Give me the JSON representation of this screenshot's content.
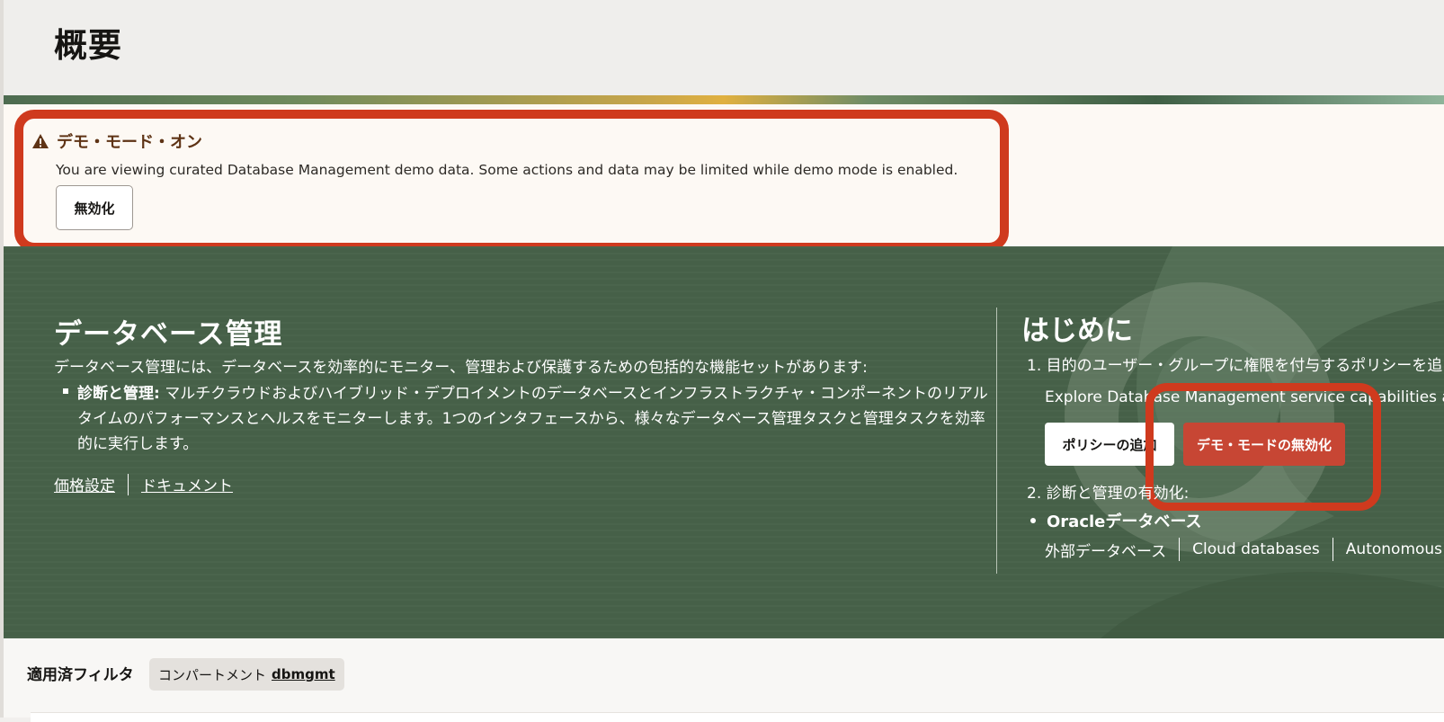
{
  "header": {
    "title": "概要"
  },
  "demo_banner": {
    "title": "デモ・モード・オン",
    "message": "You are viewing curated Database Management demo data. Some actions and data may be limited while demo mode is enabled.",
    "disable_label": "無効化",
    "warning_color": "#5e3315"
  },
  "hero": {
    "title": "データベース管理",
    "description": "データベース管理には、データベースを効率的にモニター、管理および保護するための包括的な機能セットがあります:",
    "bullet_bold": "診断と管理:",
    "bullet_text": " マルチクラウドおよびハイブリッド・デプロイメントのデータベースとインフラストラクチャ・コンポーネントのリアルタイムのパフォーマンスとヘルスをモニターします。1つのインタフェースから、様々なデータベース管理タスクと管理タスクを効率的に実行します。",
    "links": {
      "pricing": "価格設定",
      "docs": "ドキュメント"
    },
    "background_color": "#466048"
  },
  "getting_started": {
    "title": "はじめに",
    "step1": "1. 目的のユーザー・グループに権限を付与するポリシーを追",
    "explore": "Explore Database Management service capabilities a",
    "add_policy_label": "ポリシーの追加",
    "disable_demo_label": "デモ・モードの無効化",
    "step2": "2. 診断と管理の有効化:",
    "oracle_db": "Oracleデータベース",
    "db_links": [
      "外部データベース",
      "Cloud databases",
      "Autonomous"
    ],
    "primary_color": "#c74634"
  },
  "filters": {
    "label": "適用済フィルタ",
    "chip_key": "コンパートメント",
    "chip_value": "dbmgmt"
  }
}
